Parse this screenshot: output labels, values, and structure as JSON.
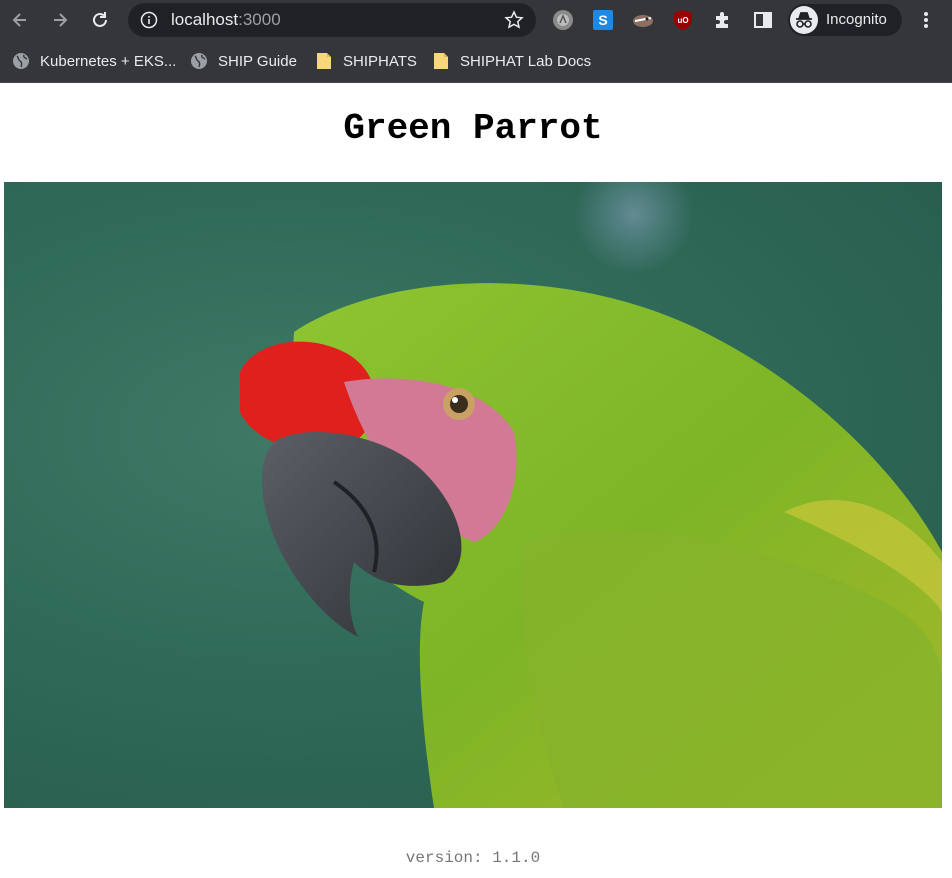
{
  "browser": {
    "url_host": "localhost",
    "url_port": ":3000",
    "profile_label": "Incognito",
    "bookmarks": [
      {
        "label": "Kubernetes + EKS...",
        "icon": "globe-icon"
      },
      {
        "label": "SHIP Guide",
        "icon": "globe-icon"
      },
      {
        "label": "SHIPHATS",
        "icon": "document-icon"
      },
      {
        "label": "SHIPHAT Lab Docs",
        "icon": "document-icon"
      }
    ],
    "extensions": [
      "extension-a-icon",
      "extension-s-icon",
      "extension-badger-icon",
      "ublock-icon",
      "puzzle-icon",
      "side-panel-icon"
    ]
  },
  "page": {
    "title": "Green Parrot",
    "image_subject": "green-parrot-photo",
    "version_text": "version: 1.1.0"
  },
  "colors": {
    "chrome_bg": "#35363a",
    "omnibox_bg": "#202124",
    "page_bg": "#ffffff"
  }
}
